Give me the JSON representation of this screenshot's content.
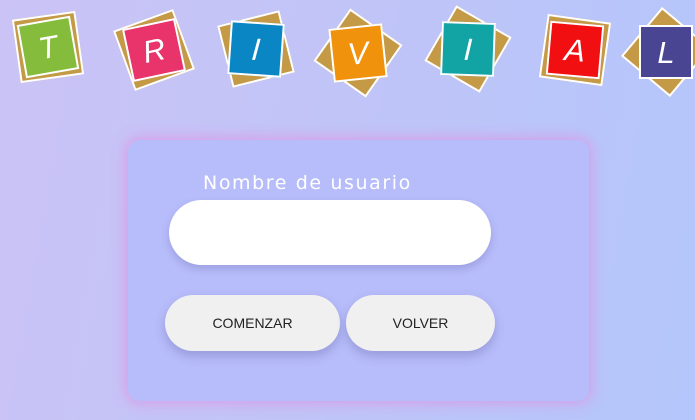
{
  "title": {
    "letters": [
      {
        "char": "T",
        "color": "#86bc3c"
      },
      {
        "char": "R",
        "color": "#e8336b"
      },
      {
        "char": "I",
        "color": "#0b86c4"
      },
      {
        "char": "V",
        "color": "#f0920b"
      },
      {
        "char": "I",
        "color": "#12a4a4"
      },
      {
        "char": "A",
        "color": "#f20f12"
      },
      {
        "char": "L",
        "color": "#4a4593"
      }
    ]
  },
  "form": {
    "username_label": "Nombre de usuario",
    "username_value": "",
    "username_placeholder": "",
    "start_button": "COMENZAR",
    "back_button": "VOLVER"
  },
  "colors": {
    "tile_back": "#c49a46",
    "tile_border": "#ffffff",
    "button_bg": "#f0f0f0",
    "card_glow": "#dc96e6"
  }
}
